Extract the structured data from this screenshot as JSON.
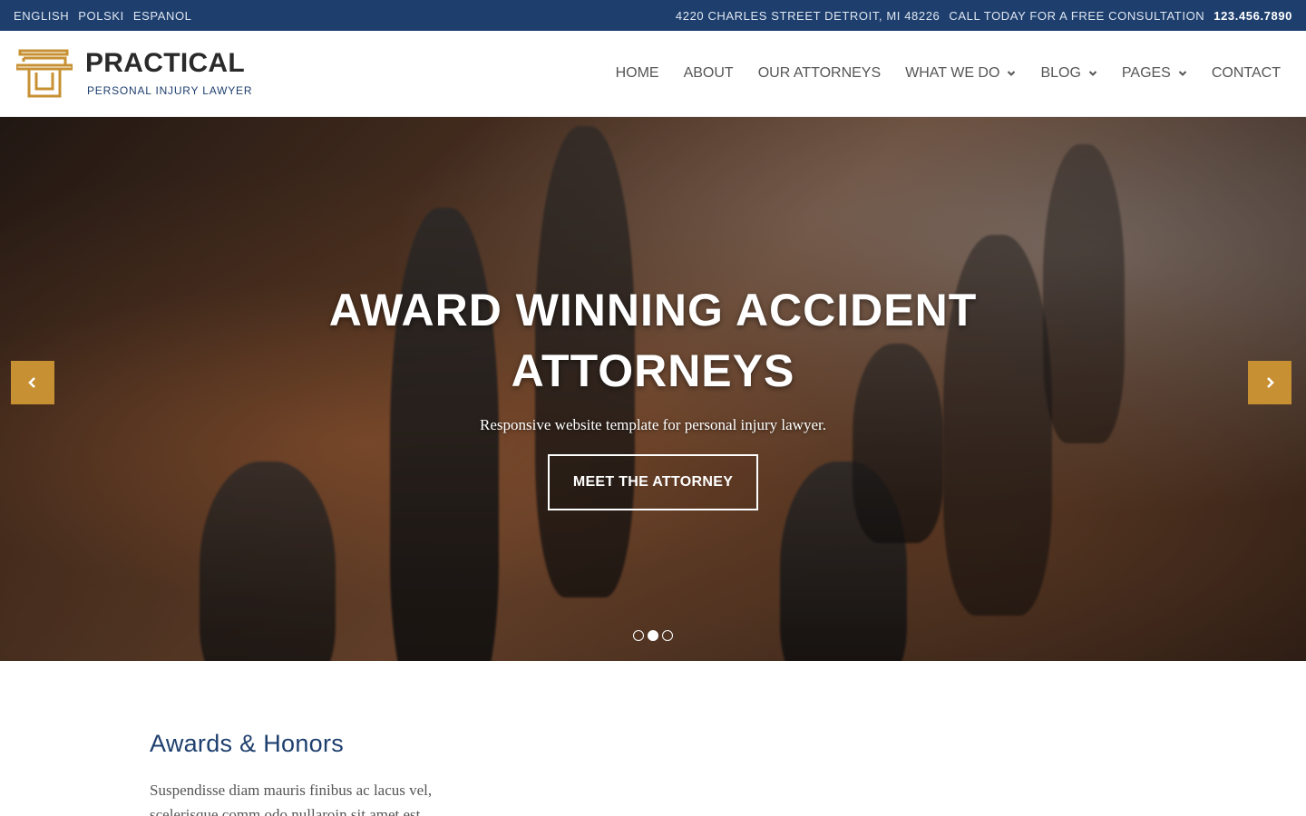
{
  "topbar": {
    "languages": [
      "ENGLISH",
      "POLSKI",
      "ESPANOL"
    ],
    "address": "4220 CHARLES STREET DETROIT, MI 48226",
    "cta": "CALL TODAY FOR A FREE CONSULTATION",
    "phone": "123.456.7890"
  },
  "brand": {
    "name": "PRACTICAL",
    "tagline": "PERSONAL INJURY LAWYER",
    "accent_color": "#c79033"
  },
  "nav": {
    "items": [
      {
        "label": "HOME",
        "has_dropdown": false
      },
      {
        "label": "ABOUT",
        "has_dropdown": false
      },
      {
        "label": "OUR ATTORNEYS",
        "has_dropdown": false
      },
      {
        "label": "WHAT WE DO",
        "has_dropdown": true
      },
      {
        "label": "BLOG",
        "has_dropdown": true
      },
      {
        "label": "PAGES",
        "has_dropdown": true
      },
      {
        "label": "CONTACT",
        "has_dropdown": false
      }
    ]
  },
  "hero": {
    "title": "AWARD WINNING ACCIDENT ATTORNEYS",
    "subtitle": "Responsive website template for personal injury lawyer.",
    "button_label": "MEET THE ATTORNEY",
    "slides_total": 3,
    "active_slide": 2
  },
  "awards": {
    "heading": "Awards & Honors",
    "text": "Suspendisse diam mauris finibus ac lacus vel, scelerisque comm odo nullaroin sit amet est"
  },
  "colors": {
    "topbar_bg": "#1e3f6e",
    "accent": "#c79033",
    "heading_blue": "#1e3f6e"
  }
}
